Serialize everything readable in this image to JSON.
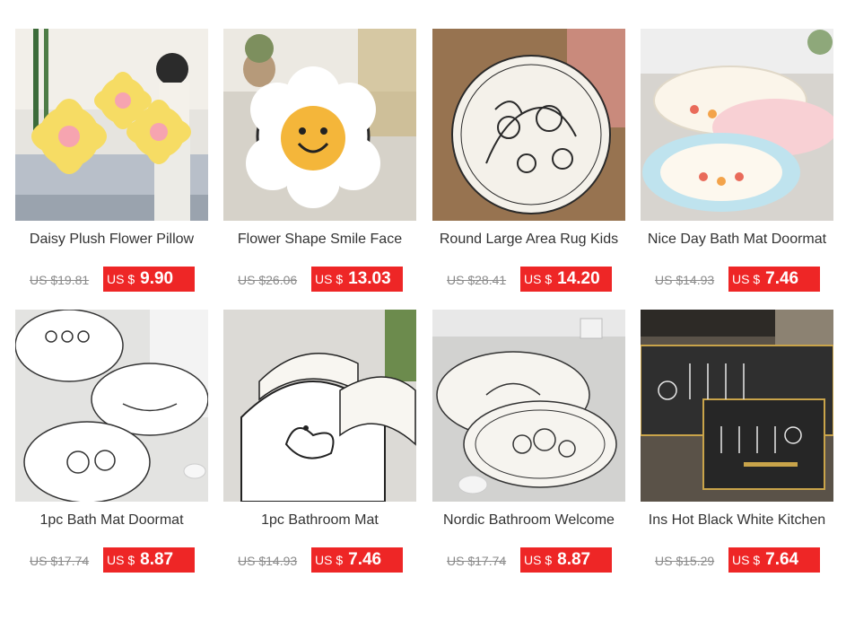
{
  "currency_label": "US $",
  "products": [
    {
      "title": "Daisy Plush Flower Pillow",
      "old_price": "US $19.81",
      "sale_price": "9.90",
      "image": "yellow daisy pillows"
    },
    {
      "title": "Flower Shape Smile Face",
      "old_price": "US $26.06",
      "sale_price": "13.03",
      "image": "smile flower rug"
    },
    {
      "title": "Round Large Area Rug Kids",
      "old_price": "US $28.41",
      "sale_price": "14.20",
      "image": "round botanical rug"
    },
    {
      "title": "Nice Day Bath Mat Doormat",
      "old_price": "US $14.93",
      "sale_price": "7.46",
      "image": "pastel bath mats"
    },
    {
      "title": "1pc Bath Mat Doormat",
      "old_price": "US $17.74",
      "sale_price": "8.87",
      "image": "line drawing bath mats"
    },
    {
      "title": "1pc Bathroom Mat",
      "old_price": "US $14.93",
      "sale_price": "7.46",
      "image": "duck bathroom mat"
    },
    {
      "title": "Nordic Bathroom Welcome",
      "old_price": "US $17.74",
      "sale_price": "8.87",
      "image": "floral oval mats"
    },
    {
      "title": "Ins Hot Black White Kitchen",
      "old_price": "US $15.29",
      "sale_price": "7.64",
      "image": "black kitchen mat"
    }
  ]
}
